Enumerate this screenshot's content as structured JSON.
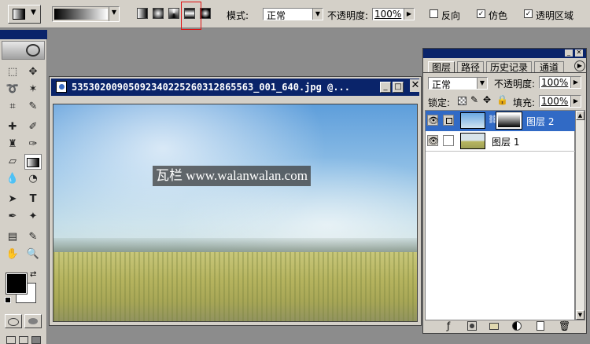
{
  "options_bar": {
    "mode_label": "模式:",
    "mode_value": "正常",
    "opacity_label": "不透明度:",
    "opacity_value": "100%",
    "reverse_label": "反向",
    "dither_label": "仿色",
    "transparency_label": "透明区域",
    "reverse_checked": false,
    "dither_checked": true,
    "transparency_checked": true,
    "gradient_types": [
      "linear-gradient-icon",
      "radial-gradient-icon",
      "angle-gradient-icon",
      "reflected-gradient-icon",
      "diamond-gradient-icon"
    ],
    "selected_gradient_type": "reflected-gradient-icon",
    "highlight_color": "#e01010"
  },
  "document": {
    "title": "5353020090509234022526031286556З_001_640.jpg @...",
    "watermark": "瓦栏 www.walanwalan.com"
  },
  "layers_panel": {
    "tabs": [
      "图层",
      "路径",
      "历史记录",
      "通道"
    ],
    "active_tab": "图层",
    "blend_mode": "正常",
    "opacity_label": "不透明度:",
    "opacity_value": "100%",
    "lock_label": "锁定:",
    "fill_label": "填充:",
    "fill_value": "100%",
    "layers": [
      {
        "name": "图层 2",
        "selected": true,
        "has_mask": true
      },
      {
        "name": "图层 1",
        "selected": false,
        "has_mask": false
      }
    ]
  },
  "colors": {
    "titlebar": "#0a246a",
    "selection": "#316ac5",
    "foreground": "#000000",
    "background": "#ffffff"
  }
}
